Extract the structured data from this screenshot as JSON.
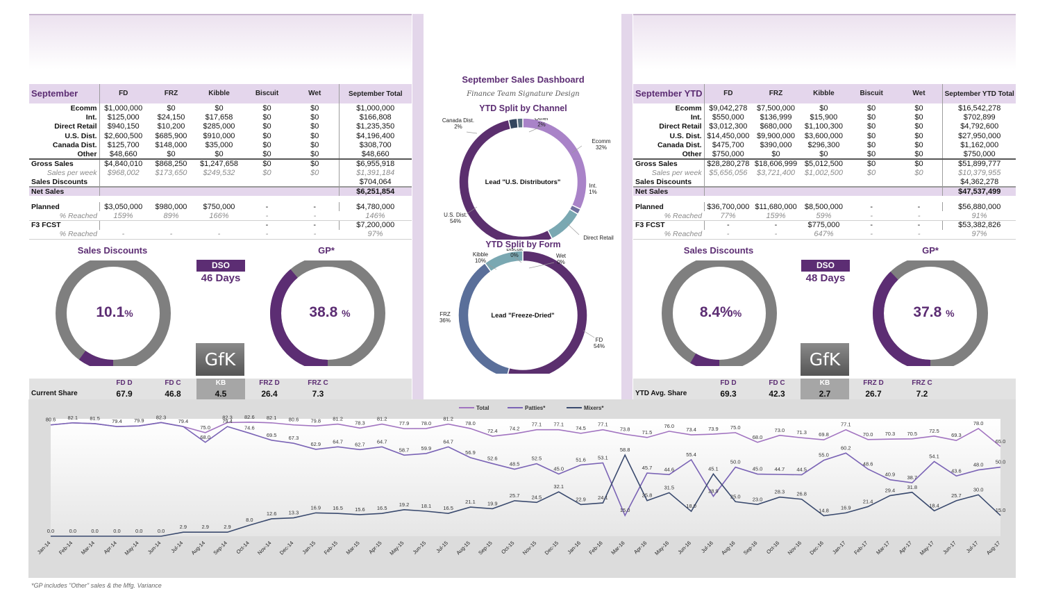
{
  "colors": {
    "purple": "#5c2d73",
    "light_purple": "#e4d6ec",
    "gray": "#7f7f7f",
    "teal": "#7aa8b2",
    "slate": "#5a6f9a",
    "series_total": "#a173c0",
    "series_patties": "#7a63b5",
    "series_mixers": "#3a4a6e"
  },
  "left_table": {
    "header": [
      "September",
      "FD",
      "FRZ",
      "Kibble",
      "Biscuit",
      "Wet",
      "September Total"
    ],
    "rows": [
      {
        "label": "Ecomm",
        "values": [
          "$1,000,000",
          "$0",
          "$0",
          "$0",
          "$0",
          "$1,000,000"
        ]
      },
      {
        "label": "Int.",
        "values": [
          "$125,000",
          "$24,150",
          "$17,658",
          "$0",
          "$0",
          "$166,808"
        ]
      },
      {
        "label": "Direct Retail",
        "values": [
          "$940,150",
          "$10,200",
          "$285,000",
          "$0",
          "$0",
          "$1,235,350"
        ]
      },
      {
        "label": "U.S. Dist.",
        "values": [
          "$2,600,500",
          "$685,900",
          "$910,000",
          "$0",
          "$0",
          "$4,196,400"
        ]
      },
      {
        "label": "Canada Dist.",
        "values": [
          "$125,700",
          "$148,000",
          "$35,000",
          "$0",
          "$0",
          "$308,700"
        ]
      },
      {
        "label": "Other",
        "values": [
          "$48,660",
          "$0",
          "$0",
          "$0",
          "$0",
          "$48,660"
        ]
      }
    ],
    "gross": {
      "label": "Gross Sales",
      "values": [
        "$4,840,010",
        "$868,250",
        "$1,247,658",
        "$0",
        "$0",
        "$6,955,918"
      ]
    },
    "per_week": {
      "label": "Sales per week",
      "values": [
        "$968,002",
        "$173,650",
        "$249,532",
        "$0",
        "$0",
        "$1,391,184"
      ]
    },
    "discounts": {
      "label": "Sales Discounts",
      "total": "$704,064"
    },
    "net": {
      "label": "Net Sales",
      "total": "$6,251,854"
    },
    "planned": {
      "label": "Planned",
      "values": [
        "$3,050,000",
        "$980,000",
        "$750,000",
        "-",
        "-",
        "$4,780,000"
      ]
    },
    "planned_reached": {
      "label": "% Reached",
      "values": [
        "159%",
        "89%",
        "166%",
        "-",
        "-",
        "146%"
      ]
    },
    "fcst": {
      "label": "F3 FCST",
      "values": [
        "",
        "",
        "",
        "-",
        "-",
        "$7,200,000"
      ]
    },
    "fcst_reached": {
      "label": "% Reached",
      "values": [
        "-",
        "-",
        "-",
        "-",
        "-",
        "97%"
      ]
    }
  },
  "right_table": {
    "header": [
      "September YTD",
      "FD",
      "FRZ",
      "Kibble",
      "Biscuit",
      "Wet",
      "September YTD Total"
    ],
    "rows": [
      {
        "label": "Ecomm",
        "values": [
          "$9,042,278",
          "$7,500,000",
          "$0",
          "$0",
          "$0",
          "$16,542,278"
        ]
      },
      {
        "label": "Int.",
        "values": [
          "$550,000",
          "$136,999",
          "$15,900",
          "$0",
          "$0",
          "$702,899"
        ]
      },
      {
        "label": "Direct Retail",
        "values": [
          "$3,012,300",
          "$680,000",
          "$1,100,300",
          "$0",
          "$0",
          "$4,792,600"
        ]
      },
      {
        "label": "U.S. Dist.",
        "values": [
          "$14,450,000",
          "$9,900,000",
          "$3,600,000",
          "$0",
          "$0",
          "$27,950,000"
        ]
      },
      {
        "label": "Canada Dist.",
        "values": [
          "$475,700",
          "$390,000",
          "$296,300",
          "$0",
          "$0",
          "$1,162,000"
        ]
      },
      {
        "label": "Other",
        "values": [
          "$750,000",
          "$0",
          "$0",
          "$0",
          "$0",
          "$750,000"
        ]
      }
    ],
    "gross": {
      "label": "Gross Sales",
      "values": [
        "$28,280,278",
        "$18,606,999",
        "$5,012,500",
        "$0",
        "$0",
        "$51,899,777"
      ]
    },
    "per_week": {
      "label": "Sales per week",
      "values": [
        "$5,656,056",
        "$3,721,400",
        "$1,002,500",
        "$0",
        "$0",
        "$10,379,955"
      ]
    },
    "discounts": {
      "label": "Sales Discounts",
      "total": "$4,362,278"
    },
    "net": {
      "label": "Net Sales",
      "total": "$47,537,499"
    },
    "planned": {
      "label": "Planned",
      "values": [
        "$36,700,000",
        "$11,680,000",
        "$8,500,000",
        "-",
        "-",
        "$56,880,000"
      ]
    },
    "planned_reached": {
      "label": "% Reached",
      "values": [
        "77%",
        "159%",
        "59%",
        "-",
        "-",
        "91%"
      ]
    },
    "fcst": {
      "label": "F3 FCST",
      "values": [
        "-",
        "-",
        "$775,000",
        "-",
        "-",
        "$53,382,826"
      ]
    },
    "fcst_reached": {
      "label": "% Reached",
      "values": [
        "-",
        "-",
        "647%",
        "-",
        "-",
        "97%"
      ]
    }
  },
  "left_gauges": {
    "sales_discounts": {
      "title": "Sales Discounts",
      "value": "10.1",
      "unit": "%",
      "fraction": 0.101
    },
    "gp": {
      "title": "GP*",
      "value": "38.8",
      "unit": "%",
      "fraction": 0.388
    },
    "dso": {
      "label": "DSO",
      "days": "46 Days"
    },
    "logo": "GfK"
  },
  "right_gauges": {
    "sales_discounts": {
      "title": "Sales Discounts",
      "value": "8.4%",
      "unit": "%",
      "fraction": 0.084
    },
    "gp": {
      "title": "GP*",
      "value": "37.8",
      "unit": "%",
      "fraction": 0.378
    },
    "dso": {
      "label": "DSO",
      "days": "48 Days"
    },
    "logo": "GfK"
  },
  "left_share": {
    "label": "Current Share",
    "headers": [
      "FD D",
      "FD C",
      "KB",
      "FRZ D",
      "FRZ C"
    ],
    "values": [
      "67.9",
      "46.8",
      "4.5",
      "26.4",
      "7.3"
    ]
  },
  "right_share": {
    "label": "YTD Avg. Share",
    "headers": [
      "FD D",
      "FD C",
      "KB",
      "FRZ D",
      "FRZ C"
    ],
    "values": [
      "69.3",
      "42.3",
      "2.7",
      "26.7",
      "7.2"
    ]
  },
  "center": {
    "title": "September Sales Dashboard",
    "signature": "Finance Team Signature Design",
    "channel": {
      "title": "YTD Split by Channel",
      "center_label": "Lead \"U.S. Distributors\"",
      "slices": [
        {
          "name": "Ecomm",
          "pct": "32%",
          "value": 32,
          "color": "#a983c8"
        },
        {
          "name": "Int.",
          "pct": "1%",
          "value": 1.4,
          "color": "#6f6f9e"
        },
        {
          "name": "Direct Retail",
          "pct": "9%",
          "value": 9,
          "color": "#7aa8b2"
        },
        {
          "name": "U.S. Dist.",
          "pct": "54%",
          "value": 54,
          "color": "#5b2f6e"
        },
        {
          "name": "Canada Dist.",
          "pct": "2%",
          "value": 2.2,
          "color": "#34465e"
        },
        {
          "name": "Other",
          "pct": "2%",
          "value": 1.4,
          "color": "#5a7080"
        }
      ]
    },
    "form": {
      "title": "YTD Split by Form",
      "center_label": "Lead \"Freeze-Dried\"",
      "slices": [
        {
          "name": "FD",
          "pct": "54%",
          "value": 54,
          "color": "#5b2f6e"
        },
        {
          "name": "FRZ",
          "pct": "36%",
          "value": 36,
          "color": "#5a6f9a"
        },
        {
          "name": "Kibble",
          "pct": "10%",
          "value": 10,
          "color": "#7aa8b2"
        },
        {
          "name": "Biscuit",
          "pct": "0%",
          "value": 0,
          "color": "#aaa"
        },
        {
          "name": "Wet",
          "pct": "0%",
          "value": 0,
          "color": "#aaa"
        }
      ]
    }
  },
  "chart_data": {
    "type": "line",
    "legend": [
      "Total",
      "Patties*",
      "Mixers*"
    ],
    "x": [
      "Jan-14",
      "Feb-14",
      "Mar-14",
      "Apr-14",
      "May-14",
      "Jun-14",
      "Jul-14",
      "Aug-14",
      "Sep-14",
      "Oct-14",
      "Nov-14",
      "Dec-14",
      "Jan-15",
      "Feb-15",
      "Mar-15",
      "Apr-15",
      "May-15",
      "Jun-15",
      "Jul-15",
      "Aug-15",
      "Sep-15",
      "Oct-15",
      "Nov-15",
      "Dec-15",
      "Jan-16",
      "Feb-16",
      "Mar-16",
      "Apr-16",
      "May-16",
      "Jun-16",
      "Jul-16",
      "Aug-16",
      "Sep-16",
      "Oct-16",
      "Nov-16",
      "Dec-16",
      "Jan-17",
      "Feb-17",
      "Mar-17",
      "Apr-17",
      "May-17",
      "Jun-17",
      "Jul-17",
      "Aug-17"
    ],
    "series": [
      {
        "name": "Total",
        "values": [
          80.6,
          82.1,
          81.5,
          79.4,
          79.9,
          82.3,
          79.4,
          75.0,
          82.3,
          82.6,
          82.1,
          80.6,
          79.8,
          81.2,
          78.3,
          81.2,
          77.9,
          78.0,
          81.2,
          78.0,
          72.4,
          74.2,
          77.1,
          77.1,
          74.5,
          77.1,
          73.8,
          71.5,
          76.0,
          73.4,
          73.9,
          75.0,
          68.0,
          73.0,
          71.3,
          69.8,
          77.1,
          70.0,
          70.3,
          70.5,
          72.5,
          69.3,
          78.0,
          65.0
        ]
      },
      {
        "name": "Patties*",
        "values": [
          80.6,
          82.1,
          81.5,
          79.4,
          79.9,
          82.3,
          79.4,
          68.0,
          79.4,
          74.6,
          69.5,
          67.3,
          62.9,
          64.7,
          62.7,
          64.7,
          58.7,
          59.9,
          64.7,
          56.9,
          52.6,
          48.5,
          52.5,
          45.0,
          51.6,
          53.1,
          15.0,
          45.7,
          44.6,
          55.4,
          28.9,
          50.0,
          45.0,
          44.7,
          44.5,
          55.0,
          60.2,
          48.6,
          40.9,
          38.7,
          54.1,
          43.6,
          48.0,
          50.0
        ]
      },
      {
        "name": "Mixers*",
        "values": [
          0.0,
          0.0,
          0.0,
          0.0,
          0.0,
          0.0,
          2.9,
          2.9,
          2.9,
          8.0,
          12.6,
          13.3,
          16.9,
          16.5,
          15.6,
          16.5,
          19.2,
          18.1,
          16.5,
          21.1,
          19.9,
          25.7,
          24.5,
          32.1,
          22.9,
          24.1,
          58.8,
          25.8,
          31.5,
          18.0,
          45.1,
          25.0,
          23.0,
          28.3,
          26.8,
          14.8,
          16.9,
          21.4,
          29.4,
          31.8,
          18.4,
          25.7,
          30.0,
          15.0
        ]
      }
    ]
  },
  "footnote": "*GP includes \"Other\" sales & the Mfg. Variance"
}
